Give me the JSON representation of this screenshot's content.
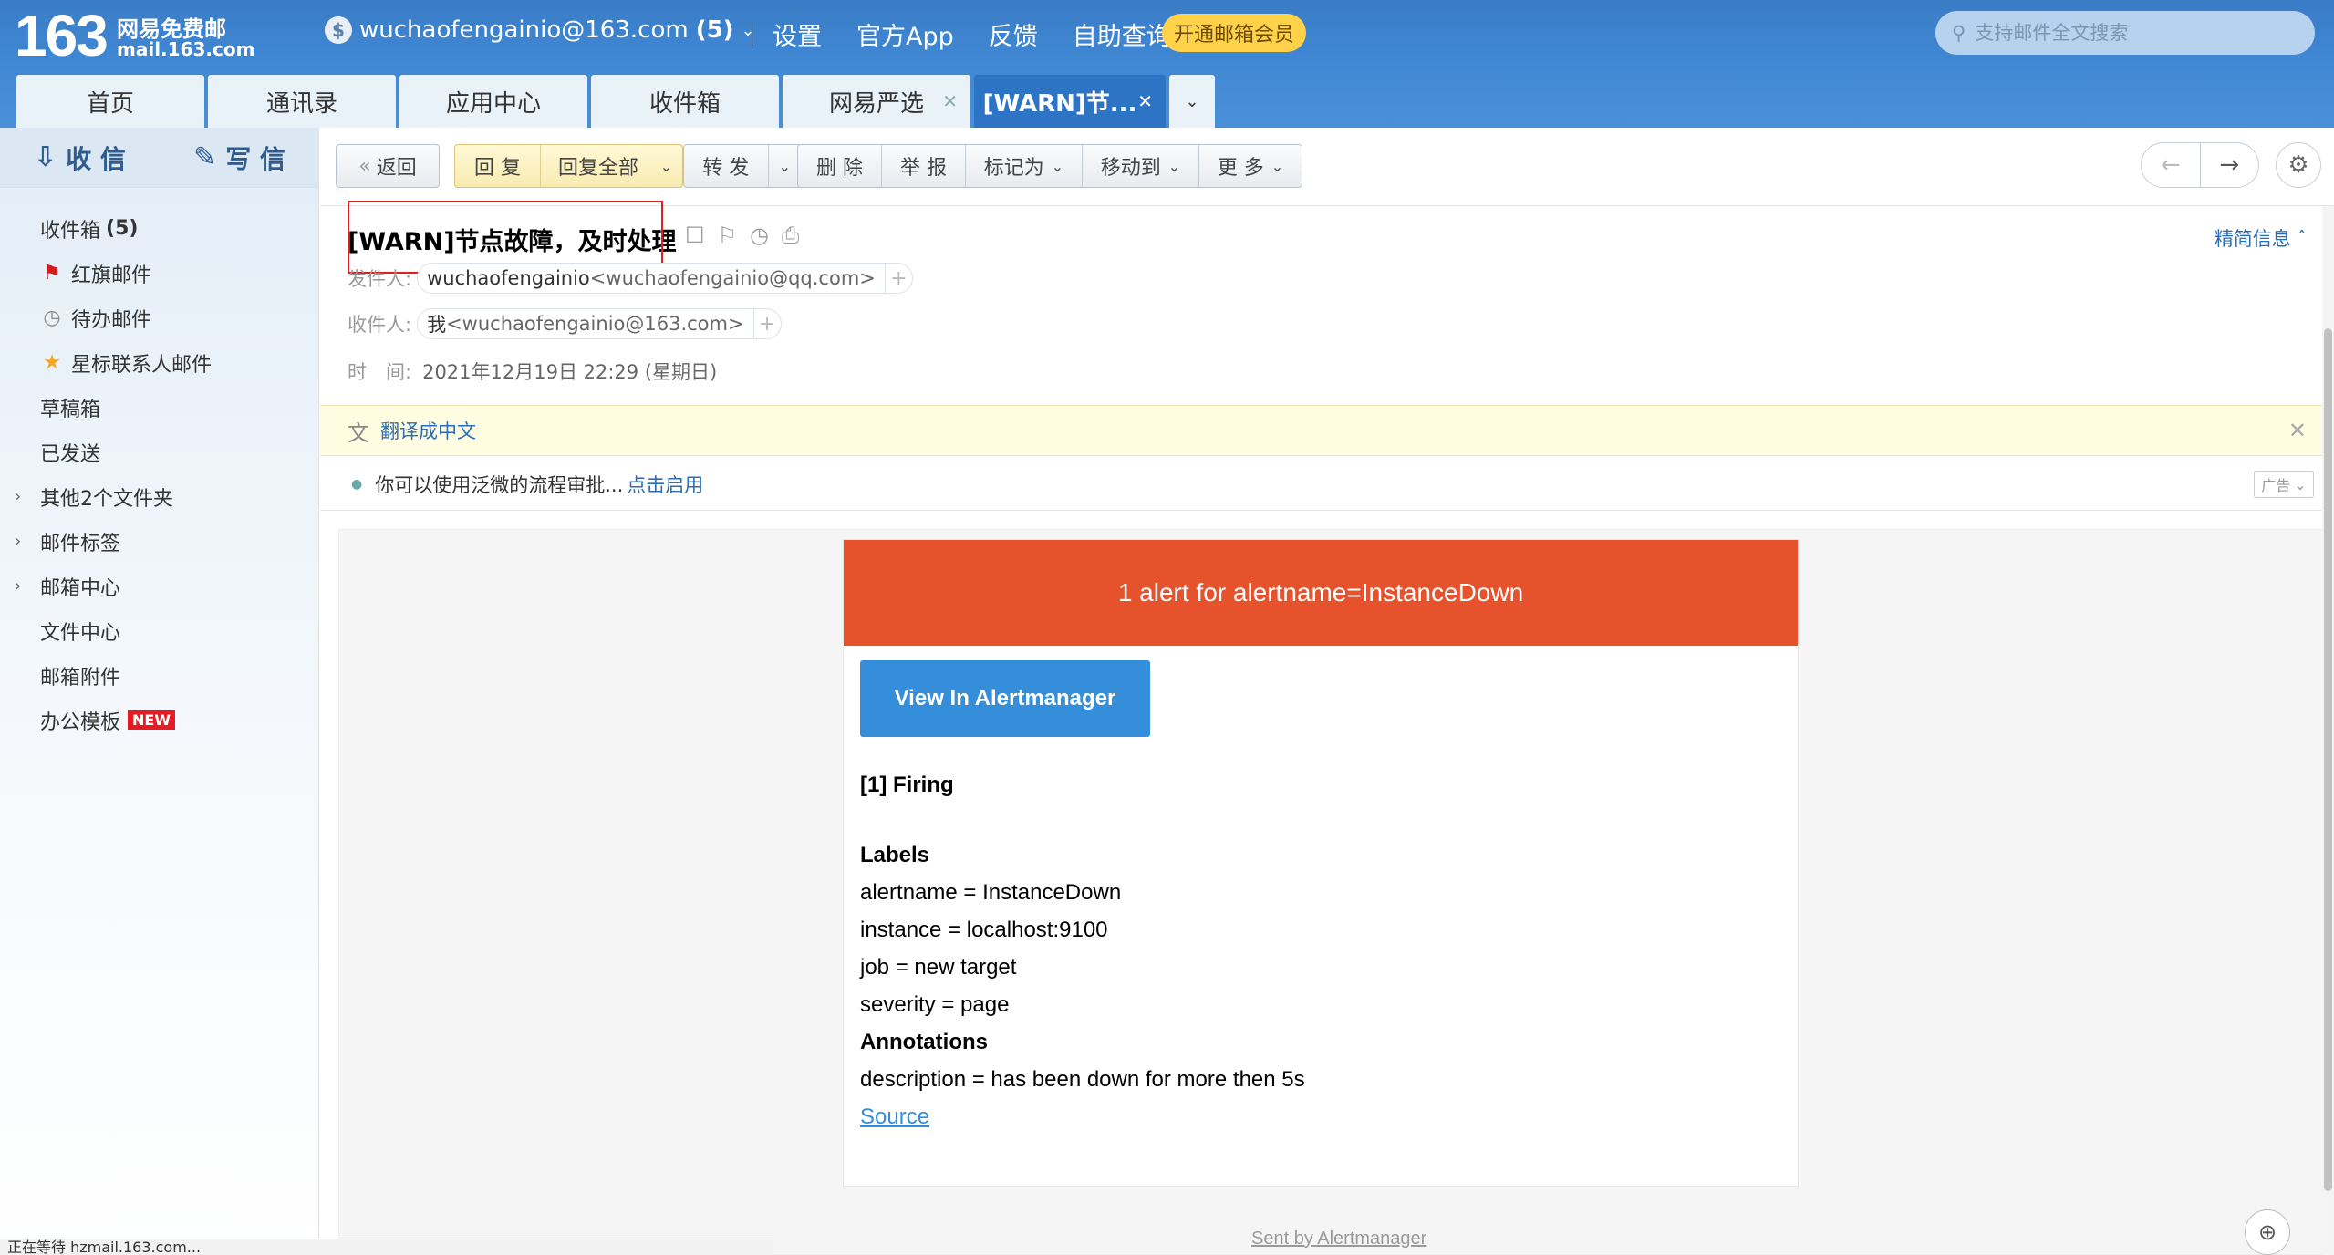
{
  "header": {
    "logo_num": "163",
    "logo_cn": "网易免费邮",
    "logo_domain": "mail.163.com",
    "account": "wuchaofengainio@163.com",
    "account_count": "(5)",
    "coin_icon": "$",
    "nav": [
      "设置",
      "官方App",
      "反馈",
      "自助查询"
    ],
    "vip_label": "开通邮箱会员",
    "search_placeholder": "支持邮件全文搜索"
  },
  "tabs": [
    {
      "label": "首页"
    },
    {
      "label": "通讯录"
    },
    {
      "label": "应用中心"
    },
    {
      "label": "收件箱"
    },
    {
      "label": "网易严选"
    },
    {
      "label": "[WARN]节..."
    }
  ],
  "sidebar": {
    "receive_label": "收 信",
    "compose_label": "写 信",
    "items": [
      {
        "label": "收件箱",
        "count": "(5)"
      },
      {
        "label": "红旗邮件"
      },
      {
        "label": "待办邮件"
      },
      {
        "label": "星标联系人邮件"
      },
      {
        "label": "草稿箱"
      },
      {
        "label": "已发送"
      },
      {
        "label": "其他2个文件夹"
      },
      {
        "label": "邮件标签"
      },
      {
        "label": "邮箱中心"
      },
      {
        "label": "文件中心"
      },
      {
        "label": "邮箱附件"
      },
      {
        "label": "办公模板",
        "badge": "NEW"
      }
    ]
  },
  "statusbar": "正在等待 hzmail.163.com...",
  "toolbar": {
    "back": "返回",
    "reply": "回 复",
    "reply_all": "回复全部",
    "forward": "转 发",
    "delete": "删 除",
    "report": "举 报",
    "mark_as": "标记为",
    "move_to": "移动到",
    "more": "更 多"
  },
  "mail": {
    "subject": "[WARN]节点故障，及时处理",
    "brief_label": "精简信息",
    "from_label": "发件人:",
    "from_name": "wuchaofengainio",
    "from_email": "<wuchaofengainio@qq.com>",
    "to_label": "收件人:",
    "to_name": "我",
    "to_email": "<wuchaofengainio@163.com>",
    "time_label": "时　间:",
    "time_value": "2021年12月19日 22:29 (星期日)",
    "translate": "翻译成中文",
    "ad_text": "你可以使用泛微的流程审批...",
    "ad_link": "点击启用",
    "ad_tag": "广告"
  },
  "alert": {
    "header": "1 alert for alertname=InstanceDown",
    "button": "View In Alertmanager",
    "firing": "[1] Firing",
    "labels_title": "Labels",
    "labels": [
      "alertname = InstanceDown",
      "instance = localhost:9100",
      "job = new target",
      "severity = page"
    ],
    "annotations_title": "Annotations",
    "annotations": [
      "description = has been down for more then 5s"
    ],
    "source": "Source",
    "footer": "Sent by Alertmanager"
  },
  "colors": {
    "header_bg": "#3f86d2",
    "alert_red": "#e6522c",
    "button_blue": "#348eda",
    "vip_yellow": "#ffd24a"
  }
}
